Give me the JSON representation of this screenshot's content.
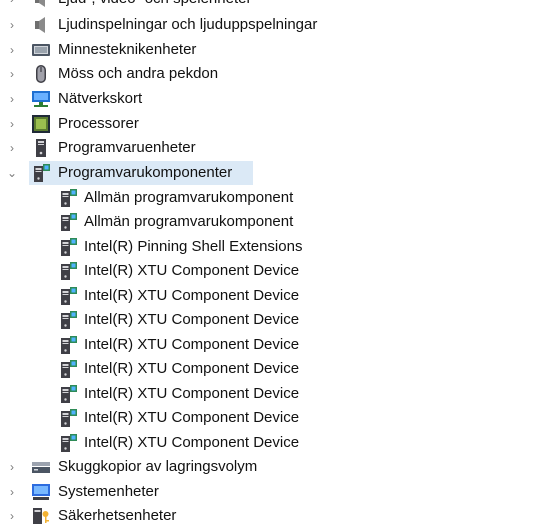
{
  "tree": {
    "top_items_before": [
      {
        "label": "Ljud-, video- och spelenheter",
        "icon": "speaker-icon"
      },
      {
        "label": "Ljudinspelningar och ljuduppspelningar",
        "icon": "speaker-icon"
      },
      {
        "label": "Minnesteknikenheter",
        "icon": "memory-device-icon"
      },
      {
        "label": "Möss och andra pekdon",
        "icon": "mouse-icon"
      },
      {
        "label": "Nätverkskort",
        "icon": "network-adapter-icon"
      },
      {
        "label": "Processorer",
        "icon": "processor-icon"
      },
      {
        "label": "Programvaruenheter",
        "icon": "software-device-icon"
      }
    ],
    "expanded_item": {
      "label": "Programvarukomponenter",
      "icon": "software-component-icon",
      "children": [
        "Allmän programvarukomponent",
        "Allmän programvarukomponent",
        "Intel(R) Pinning Shell Extensions",
        "Intel(R) XTU Component Device",
        "Intel(R) XTU Component Device",
        "Intel(R) XTU Component Device",
        "Intel(R) XTU Component Device",
        "Intel(R) XTU Component Device",
        "Intel(R) XTU Component Device",
        "Intel(R) XTU Component Device",
        "Intel(R) XTU Component Device"
      ]
    },
    "top_items_after": [
      {
        "label": "Skuggkopior av lagringsvolym",
        "icon": "storage-volume-icon"
      },
      {
        "label": "Systemenheter",
        "icon": "system-device-icon"
      },
      {
        "label": "Säkerhetsenheter",
        "icon": "security-device-icon"
      }
    ]
  },
  "colors": {
    "selection": "#dbe9f6",
    "chevron": "#7a7a7a",
    "text": "#111111"
  }
}
